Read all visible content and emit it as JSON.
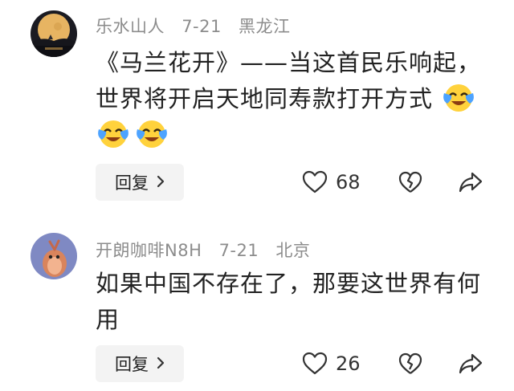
{
  "comments": [
    {
      "author": "乐水山人",
      "date": "7-21",
      "location": "黑龙江",
      "text": "《马兰花开》——当这首民乐响起，世界将开启天地同寿款打开方式",
      "emojis": [
        "crying-laughing-emoji",
        "crying-laughing-emoji",
        "crying-laughing-emoji"
      ],
      "reply_label": "回复",
      "likes": "68"
    },
    {
      "author": "开朗咖啡N8H",
      "date": "7-21",
      "location": "北京",
      "text": "如果中国不存在了，那要这世界有何用",
      "reply_label": "回复",
      "likes": "26"
    }
  ],
  "colors": {
    "meta": "#8c8c8c",
    "reply_bg": "#f3f3f3",
    "emoji_face": "#ffd23c",
    "tears": "#4da3ff"
  }
}
